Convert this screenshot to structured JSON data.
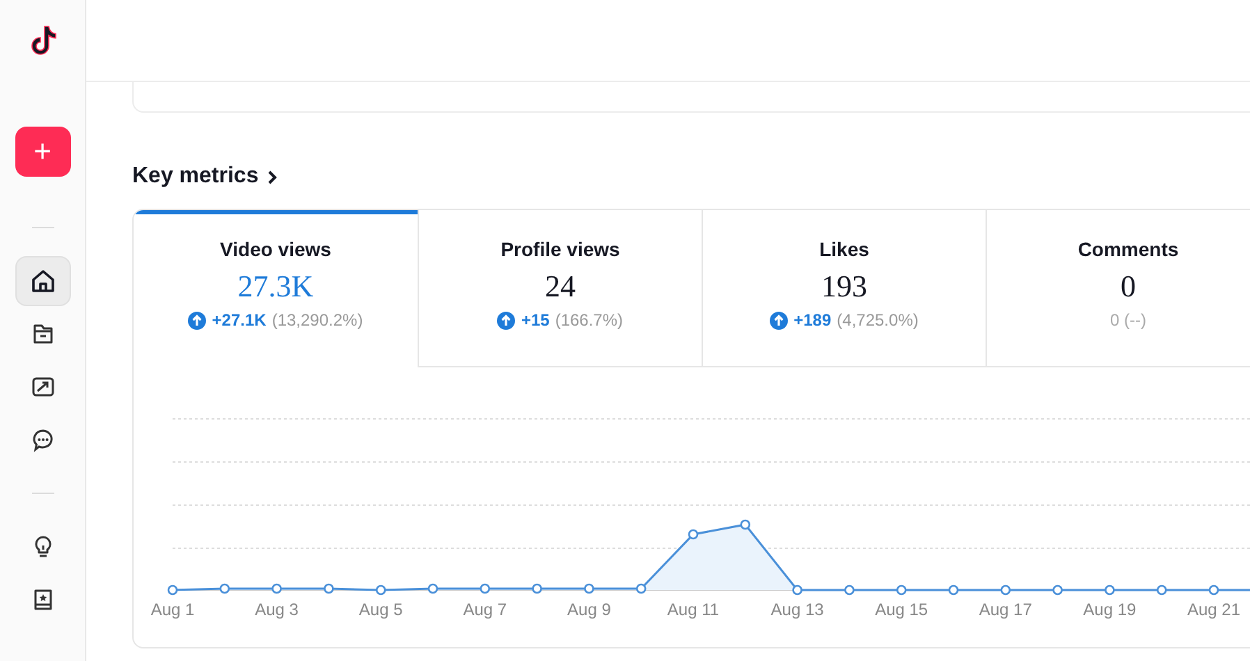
{
  "sidebar": {
    "create_button": {
      "label": "+"
    },
    "items": [
      {
        "kind": "home",
        "selected": true
      },
      {
        "kind": "folder",
        "selected": false
      },
      {
        "kind": "analytics",
        "selected": false
      },
      {
        "kind": "comments",
        "selected": false
      },
      {
        "kind": "divider"
      },
      {
        "kind": "idea",
        "selected": false
      },
      {
        "kind": "book",
        "selected": false
      }
    ]
  },
  "section": {
    "title": "Key metrics"
  },
  "metrics": [
    {
      "label": "Video views",
      "value": "27.3K",
      "kind": "up",
      "delta": "+27.1K",
      "percent": "(13,290.2%)",
      "selected": true
    },
    {
      "label": "Profile views",
      "value": "24",
      "kind": "up",
      "delta": "+15",
      "percent": "(166.7%)",
      "selected": false
    },
    {
      "label": "Likes",
      "value": "193",
      "kind": "up",
      "delta": "+189",
      "percent": "(4,725.0%)",
      "selected": false
    },
    {
      "label": "Comments",
      "value": "0",
      "kind": "flat",
      "delta": "0",
      "percent": "(--)",
      "selected": false
    }
  ],
  "chart": {
    "x_labels": [
      "Aug 1",
      "Aug 3",
      "Aug 5",
      "Aug 7",
      "Aug 9",
      "Aug 11",
      "Aug 13",
      "Aug 15",
      "Aug 17",
      "Aug 19",
      "Aug 21"
    ]
  }
}
